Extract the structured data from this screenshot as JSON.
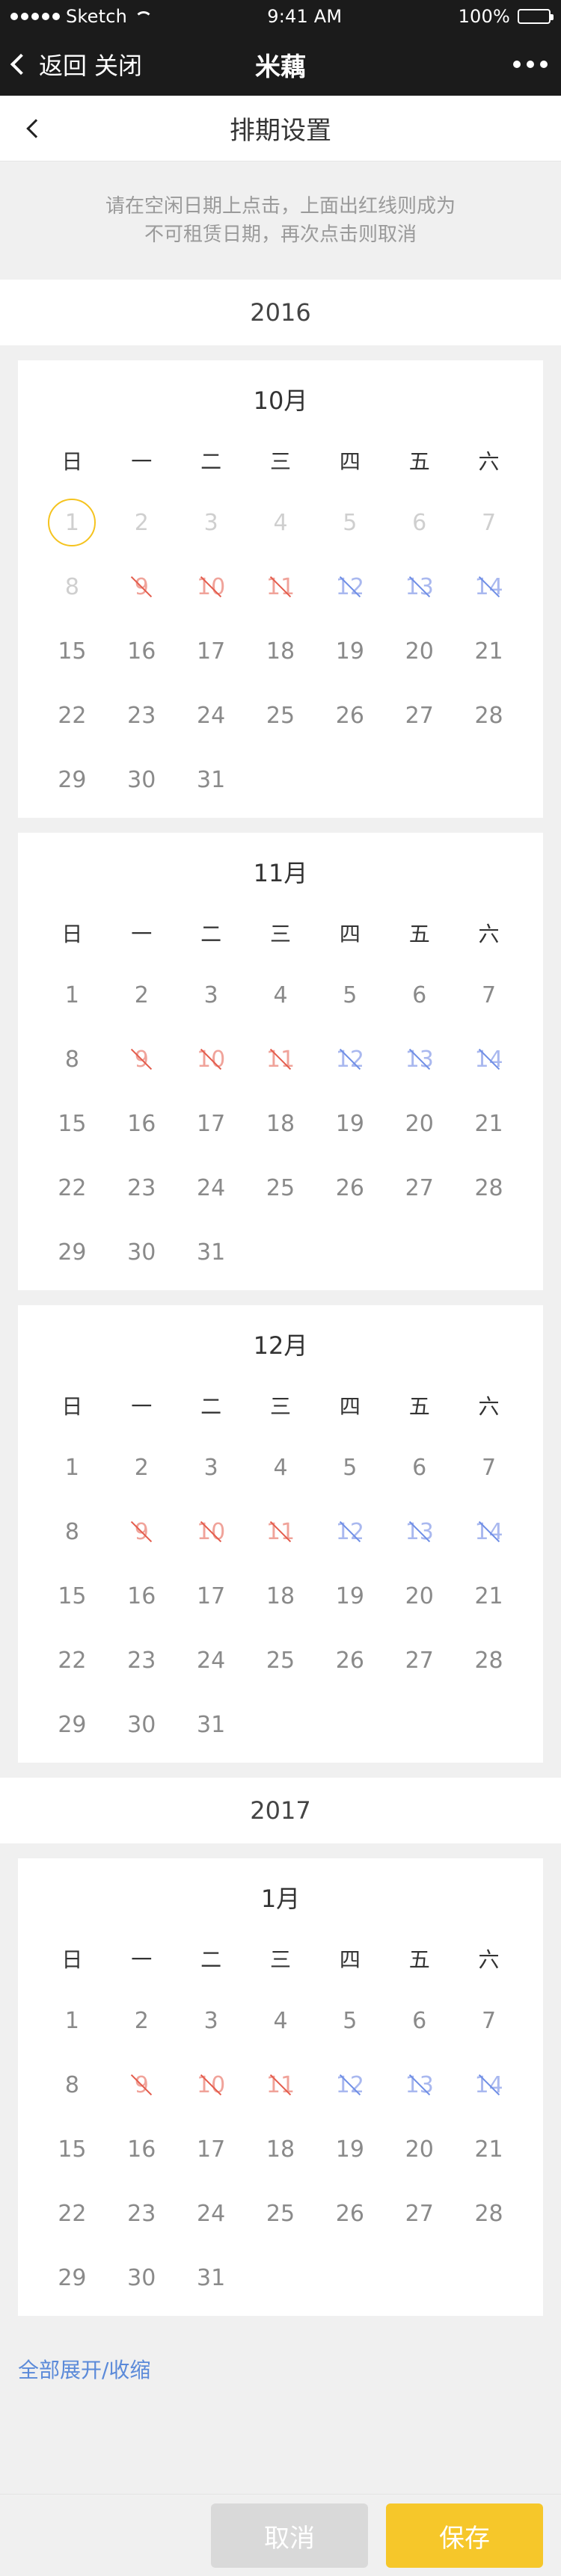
{
  "status": {
    "carrier": "Sketch",
    "time": "9:41 AM",
    "battery": "100%"
  },
  "wxnav": {
    "back": "返回",
    "close": "关闭",
    "title": "米藕"
  },
  "header": {
    "title": "排期设置"
  },
  "tip": {
    "line1": "请在空闲日期上点击，上面出红线则成为",
    "line2": "不可租赁日期，再次点击则取消"
  },
  "weekdays": [
    "日",
    "一",
    "二",
    "三",
    "四",
    "五",
    "六"
  ],
  "years": [
    {
      "label": "2016",
      "months": [
        {
          "title": "10月",
          "weeks": [
            [
              {
                "d": "1",
                "s": "today"
              },
              {
                "d": "2",
                "s": "past"
              },
              {
                "d": "3",
                "s": "past"
              },
              {
                "d": "4",
                "s": "past"
              },
              {
                "d": "5",
                "s": "past"
              },
              {
                "d": "6",
                "s": "past"
              },
              {
                "d": "7",
                "s": "past"
              }
            ],
            [
              {
                "d": "8",
                "s": "past"
              },
              {
                "d": "9",
                "s": "red"
              },
              {
                "d": "10",
                "s": "red"
              },
              {
                "d": "11",
                "s": "red"
              },
              {
                "d": "12",
                "s": "blue"
              },
              {
                "d": "13",
                "s": "blue"
              },
              {
                "d": "14",
                "s": "blue"
              }
            ],
            [
              {
                "d": "15"
              },
              {
                "d": "16"
              },
              {
                "d": "17"
              },
              {
                "d": "18"
              },
              {
                "d": "19"
              },
              {
                "d": "20"
              },
              {
                "d": "21"
              }
            ],
            [
              {
                "d": "22"
              },
              {
                "d": "23"
              },
              {
                "d": "24"
              },
              {
                "d": "25"
              },
              {
                "d": "26"
              },
              {
                "d": "27"
              },
              {
                "d": "28"
              }
            ],
            [
              {
                "d": "29"
              },
              {
                "d": "30"
              },
              {
                "d": "31"
              }
            ]
          ]
        },
        {
          "title": "11月",
          "weeks": [
            [
              {
                "d": "1"
              },
              {
                "d": "2"
              },
              {
                "d": "3"
              },
              {
                "d": "4"
              },
              {
                "d": "5"
              },
              {
                "d": "6"
              },
              {
                "d": "7"
              }
            ],
            [
              {
                "d": "8"
              },
              {
                "d": "9",
                "s": "red"
              },
              {
                "d": "10",
                "s": "red"
              },
              {
                "d": "11",
                "s": "red"
              },
              {
                "d": "12",
                "s": "blue"
              },
              {
                "d": "13",
                "s": "blue"
              },
              {
                "d": "14",
                "s": "blue"
              }
            ],
            [
              {
                "d": "15"
              },
              {
                "d": "16"
              },
              {
                "d": "17"
              },
              {
                "d": "18"
              },
              {
                "d": "19"
              },
              {
                "d": "20"
              },
              {
                "d": "21"
              }
            ],
            [
              {
                "d": "22"
              },
              {
                "d": "23"
              },
              {
                "d": "24"
              },
              {
                "d": "25"
              },
              {
                "d": "26"
              },
              {
                "d": "27"
              },
              {
                "d": "28"
              }
            ],
            [
              {
                "d": "29"
              },
              {
                "d": "30"
              },
              {
                "d": "31"
              }
            ]
          ]
        },
        {
          "title": "12月",
          "weeks": [
            [
              {
                "d": "1"
              },
              {
                "d": "2"
              },
              {
                "d": "3"
              },
              {
                "d": "4"
              },
              {
                "d": "5"
              },
              {
                "d": "6"
              },
              {
                "d": "7"
              }
            ],
            [
              {
                "d": "8"
              },
              {
                "d": "9",
                "s": "red"
              },
              {
                "d": "10",
                "s": "red"
              },
              {
                "d": "11",
                "s": "red"
              },
              {
                "d": "12",
                "s": "blue"
              },
              {
                "d": "13",
                "s": "blue"
              },
              {
                "d": "14",
                "s": "blue"
              }
            ],
            [
              {
                "d": "15"
              },
              {
                "d": "16"
              },
              {
                "d": "17"
              },
              {
                "d": "18"
              },
              {
                "d": "19"
              },
              {
                "d": "20"
              },
              {
                "d": "21"
              }
            ],
            [
              {
                "d": "22"
              },
              {
                "d": "23"
              },
              {
                "d": "24"
              },
              {
                "d": "25"
              },
              {
                "d": "26"
              },
              {
                "d": "27"
              },
              {
                "d": "28"
              }
            ],
            [
              {
                "d": "29"
              },
              {
                "d": "30"
              },
              {
                "d": "31"
              }
            ]
          ]
        }
      ]
    },
    {
      "label": "2017",
      "months": [
        {
          "title": "1月",
          "weeks": [
            [
              {
                "d": "1"
              },
              {
                "d": "2"
              },
              {
                "d": "3"
              },
              {
                "d": "4"
              },
              {
                "d": "5"
              },
              {
                "d": "6"
              },
              {
                "d": "7"
              }
            ],
            [
              {
                "d": "8"
              },
              {
                "d": "9",
                "s": "red"
              },
              {
                "d": "10",
                "s": "red"
              },
              {
                "d": "11",
                "s": "red"
              },
              {
                "d": "12",
                "s": "blue"
              },
              {
                "d": "13",
                "s": "blue"
              },
              {
                "d": "14",
                "s": "blue"
              }
            ],
            [
              {
                "d": "15"
              },
              {
                "d": "16"
              },
              {
                "d": "17"
              },
              {
                "d": "18"
              },
              {
                "d": "19"
              },
              {
                "d": "20"
              },
              {
                "d": "21"
              }
            ],
            [
              {
                "d": "22"
              },
              {
                "d": "23"
              },
              {
                "d": "24"
              },
              {
                "d": "25"
              },
              {
                "d": "26"
              },
              {
                "d": "27"
              },
              {
                "d": "28"
              }
            ],
            [
              {
                "d": "29"
              },
              {
                "d": "30"
              },
              {
                "d": "31"
              }
            ]
          ]
        }
      ]
    }
  ],
  "toggle_label": "全部展开/收缩",
  "buttons": {
    "cancel": "取消",
    "save": "保存"
  },
  "colors": {
    "accent": "#f6c72a",
    "today_ring": "#f5c31e",
    "cross_red": "#e45b4b",
    "cross_blue": "#6e8ee6",
    "link": "#5b8ad9"
  }
}
